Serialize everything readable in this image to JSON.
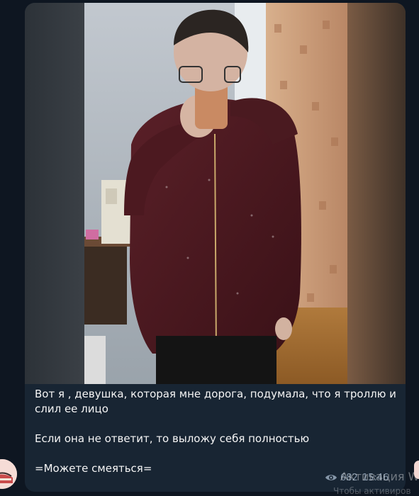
{
  "message": {
    "photo_alt": "photo",
    "caption_lines": [
      "Вот я , девушка, которая мне дорога, подумала, что я троллю и слил ее лицо",
      "",
      "Если она не ответит, то выложу себя полностью",
      "",
      "=Можете смеяться="
    ],
    "views": "682",
    "time": "15:46"
  },
  "watermark": {
    "title": "Активация W",
    "subtitle": "Чтобы активиров"
  },
  "icons": {
    "views": "eye-icon"
  },
  "colors": {
    "background": "#0e1621",
    "bubble": "#182533",
    "text": "#f5f5f5",
    "meta": "#8596a8"
  }
}
